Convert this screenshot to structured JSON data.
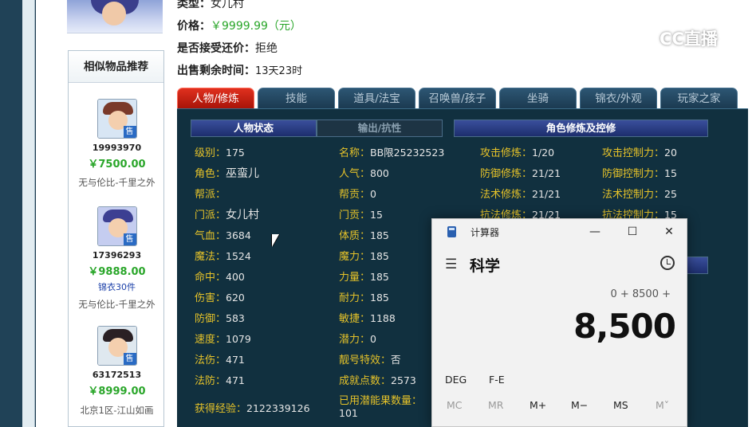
{
  "listing": {
    "type_label": "类型：",
    "type_value": "女儿村",
    "price_label": "价格：",
    "price_value": "￥9999.99（元）",
    "bargain_label": "是否接受还价：",
    "bargain_value": "拒绝",
    "remaining_label": "出售剩余时间：",
    "remaining_value": "13天23时"
  },
  "similar": {
    "title": "相似物品推荐",
    "items": [
      {
        "id": "19993970",
        "price": "￥7500.00",
        "server": "无与伦比-千里之外",
        "sale": "售",
        "extra": ""
      },
      {
        "id": "17396293",
        "price": "￥9888.00",
        "server": "无与伦比-千里之外",
        "sale": "售",
        "extra": "锦衣30件"
      },
      {
        "id": "63172513",
        "price": "￥8999.00",
        "server": "北京1区-江山如画",
        "sale": "售",
        "extra": ""
      }
    ]
  },
  "tabs": [
    "人物/修炼",
    "技能",
    "道具/法宝",
    "召唤兽/孩子",
    "坐骑",
    "锦衣/外观",
    "玩家之家"
  ],
  "subtabs": {
    "status": "人物状态",
    "attack": "输出/抗性",
    "cultivation": "角色修炼及控修"
  },
  "stats": {
    "col1": [
      {
        "k": "级别：",
        "v": "175"
      },
      {
        "k": "角色：",
        "v": "巫蛮儿"
      },
      {
        "k": "帮派：",
        "v": ""
      },
      {
        "k": "门派：",
        "v": "女儿村"
      },
      {
        "k": "气血：",
        "v": "3684"
      },
      {
        "k": "魔法：",
        "v": "1524"
      },
      {
        "k": "命中：",
        "v": "400"
      },
      {
        "k": "伤害：",
        "v": "620"
      },
      {
        "k": "防御：",
        "v": "583"
      },
      {
        "k": "速度：",
        "v": "1079"
      },
      {
        "k": "法伤：",
        "v": "471"
      },
      {
        "k": "法防：",
        "v": "471"
      }
    ],
    "col2": [
      {
        "k": "名称：",
        "v": "BB限25232523"
      },
      {
        "k": "人气：",
        "v": "800"
      },
      {
        "k": "帮贡：",
        "v": "0"
      },
      {
        "k": "门贡：",
        "v": "15"
      },
      {
        "k": "体质：",
        "v": "185"
      },
      {
        "k": "魔力：",
        "v": "185"
      },
      {
        "k": "力量：",
        "v": "185"
      },
      {
        "k": "耐力：",
        "v": "185"
      },
      {
        "k": "敏捷：",
        "v": "1188"
      },
      {
        "k": "潜力：",
        "v": "0"
      },
      {
        "k": "靓号特效：",
        "v": "否"
      },
      {
        "k": "成就点数：",
        "v": "2573"
      }
    ],
    "exp_label": "获得经验：",
    "exp_value": "2122339126",
    "potion_label": "已用潜能果数量：",
    "potion_value": "101",
    "cult": [
      {
        "k": "攻击修炼：",
        "v": "1/20",
        "k2": "攻击控制力：",
        "v2": "20"
      },
      {
        "k": "防御修炼：",
        "v": "21/21",
        "k2": "防御控制力：",
        "v2": "15"
      },
      {
        "k": "法术修炼：",
        "v": "21/21",
        "k2": "法术控制力：",
        "v2": "25"
      },
      {
        "k": "抗法修炼：",
        "v": "21/21",
        "k2": "抗法控制力：",
        "v2": "15"
      }
    ]
  },
  "calculator": {
    "title": "计算器",
    "mode": "科学",
    "expression": "0 + 8500 +",
    "result": "8,500",
    "window": {
      "minimize": "—",
      "maximize": "☐",
      "close": "✕"
    },
    "row1": [
      "DEG",
      "F-E"
    ],
    "memory": [
      "MC",
      "MR",
      "M+",
      "M−",
      "MS",
      "M˅"
    ]
  },
  "watermark": "CC直播",
  "colors": {
    "gold": "#e5c229",
    "green": "#2aa62a",
    "active_tab": "#c8200f"
  }
}
